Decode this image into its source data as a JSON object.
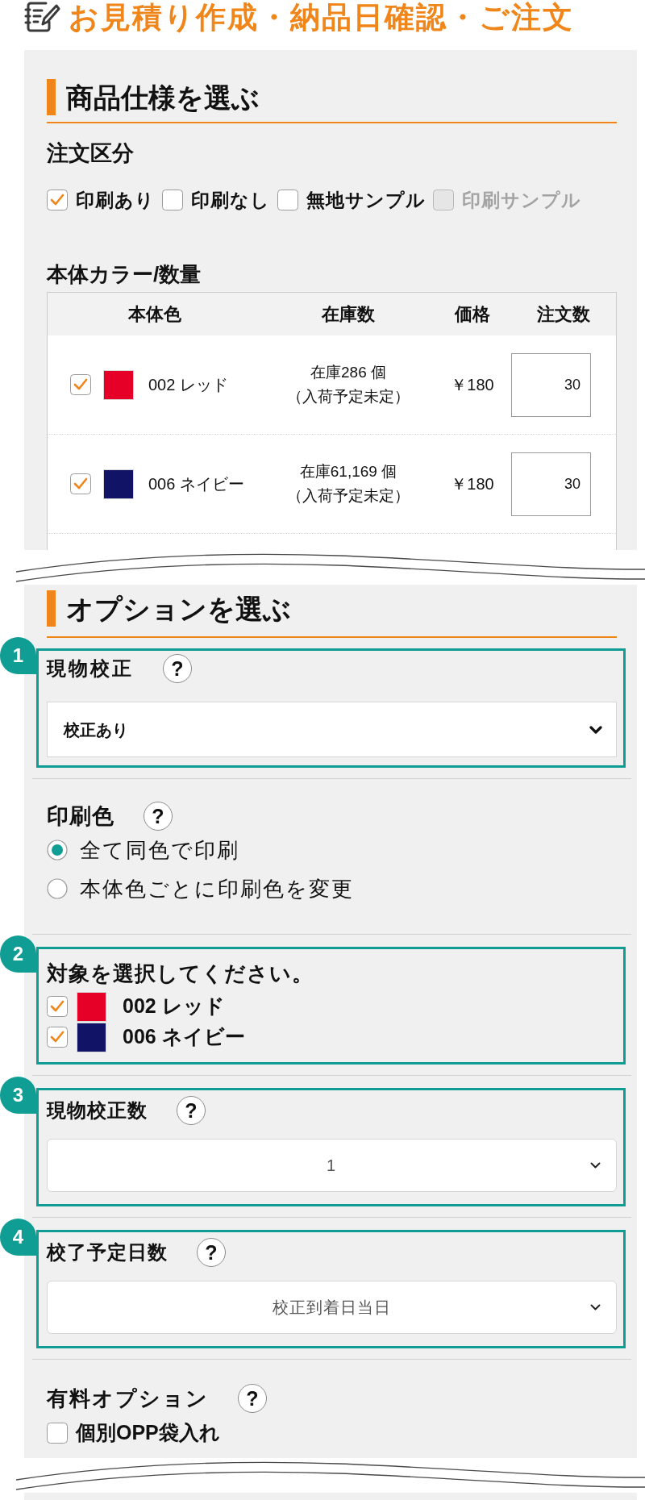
{
  "header": {
    "title": "お見積り作成・納品日確認・ご注文"
  },
  "product_section": {
    "heading": "商品仕様を選ぶ",
    "order_type": {
      "label": "注文区分",
      "options": [
        {
          "label": "印刷あり",
          "checked": true,
          "disabled": false
        },
        {
          "label": "印刷なし",
          "checked": false,
          "disabled": false
        },
        {
          "label": "無地サンプル",
          "checked": false,
          "disabled": false
        },
        {
          "label": "印刷サンプル",
          "checked": false,
          "disabled": true
        }
      ]
    },
    "color_quantity": {
      "label": "本体カラー/数量",
      "table": {
        "columns": [
          "本体色",
          "在庫数",
          "価格",
          "注文数"
        ],
        "rows": [
          {
            "checked": true,
            "color": "#e60027",
            "name": "002 レッド",
            "stock": "在庫286 個",
            "arrival": "（入荷予定未定）",
            "price": "￥180",
            "quantity": "30"
          },
          {
            "checked": true,
            "color": "#111466",
            "name": "006 ネイビー",
            "stock": "在庫61,169 個",
            "arrival": "（入荷予定未定）",
            "price": "￥180",
            "quantity": "30"
          }
        ]
      }
    }
  },
  "options_section": {
    "heading": "オプションを選ぶ",
    "groups": [
      {
        "kind": "select",
        "step": "1",
        "label": "現物校正",
        "help": "?",
        "value": "校正あり"
      },
      {
        "kind": "radio",
        "label": "印刷色",
        "help": "?",
        "options": [
          {
            "label": "全て同色で印刷",
            "selected": true
          },
          {
            "label": "本体色ごとに印刷色を変更",
            "selected": false
          }
        ]
      },
      {
        "kind": "color_checklist",
        "step": "2",
        "label": "対象を選択してください。",
        "items": [
          {
            "checked": true,
            "color": "#e60027",
            "name": "002 レッド"
          },
          {
            "checked": true,
            "color": "#111466",
            "name": "006 ネイビー"
          }
        ]
      },
      {
        "kind": "select_centered",
        "step": "3",
        "label": "現物校正数",
        "help": "?",
        "value": "1"
      },
      {
        "kind": "select_centered",
        "step": "4",
        "label": "校了予定日数",
        "help": "?",
        "value": "校正到着日当日"
      },
      {
        "kind": "checkbox",
        "label": "有料オプション",
        "help": "?",
        "options": [
          {
            "label": "個別OPP袋入れ",
            "checked": false
          }
        ]
      }
    ]
  }
}
